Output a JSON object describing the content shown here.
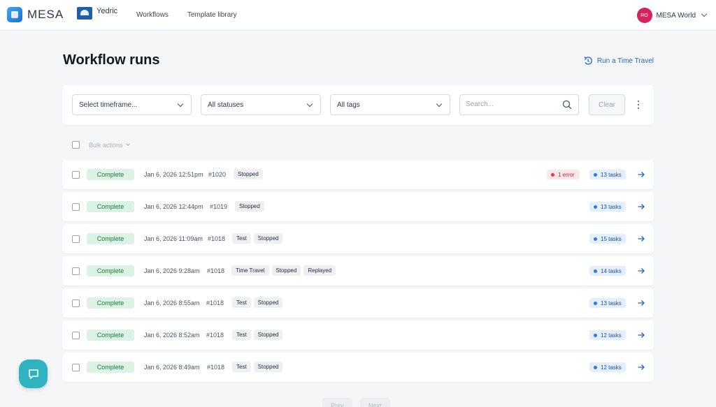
{
  "nav": {
    "brand": "MESA",
    "store": "Yedric",
    "links": [
      "Workflows",
      "Template library"
    ],
    "account_initials": "RO",
    "account_name": "MESA World"
  },
  "page": {
    "title": "Workflow runs",
    "time_travel_label": "Run a Time Travel"
  },
  "filters": {
    "timeframe": "Select timeframe...",
    "status": "All statuses",
    "tags": "All tags",
    "search_placeholder": "Search...",
    "clear_label": "Clear"
  },
  "bulk": {
    "label": "Bulk actions"
  },
  "runs": [
    {
      "status": "Complete",
      "date": "Jan 6, 2026 12:51pm",
      "run": "#1020",
      "tags": [
        "Stopped"
      ],
      "error": "1 error",
      "tasks": "13 tasks"
    },
    {
      "status": "Complete",
      "date": "Jan 6, 2026 12:44pm",
      "run": "#1019",
      "tags": [
        "Stopped"
      ],
      "error": "",
      "tasks": "13 tasks"
    },
    {
      "status": "Complete",
      "date": "Jan 6, 2026 11:09am",
      "run": "#1018",
      "tags": [
        "Test",
        "Stopped"
      ],
      "error": "",
      "tasks": "15 tasks"
    },
    {
      "status": "Complete",
      "date": "Jan 6, 2026 9:28am",
      "run": "#1018",
      "tags": [
        "Time Travel",
        "Stopped",
        "Replayed"
      ],
      "error": "",
      "tasks": "14 tasks"
    },
    {
      "status": "Complete",
      "date": "Jan 6, 2026 8:55am",
      "run": "#1018",
      "tags": [
        "Test",
        "Stopped"
      ],
      "error": "",
      "tasks": "13 tasks"
    },
    {
      "status": "Complete",
      "date": "Jan 6, 2026 8:52am",
      "run": "#1018",
      "tags": [
        "Test",
        "Stopped"
      ],
      "error": "",
      "tasks": "12 tasks"
    },
    {
      "status": "Complete",
      "date": "Jan 6, 2026 8:49am",
      "run": "#1018",
      "tags": [
        "Test",
        "Stopped"
      ],
      "error": "",
      "tasks": "12 tasks"
    }
  ],
  "pagination": {
    "prev": "Prev",
    "next": "Next"
  },
  "colors": {
    "accent": "#1f64c8",
    "complete_bg": "#dbf2e4",
    "complete_text": "#1d7a43",
    "error": "#e03a4b",
    "chat": "#2fb3c1"
  }
}
